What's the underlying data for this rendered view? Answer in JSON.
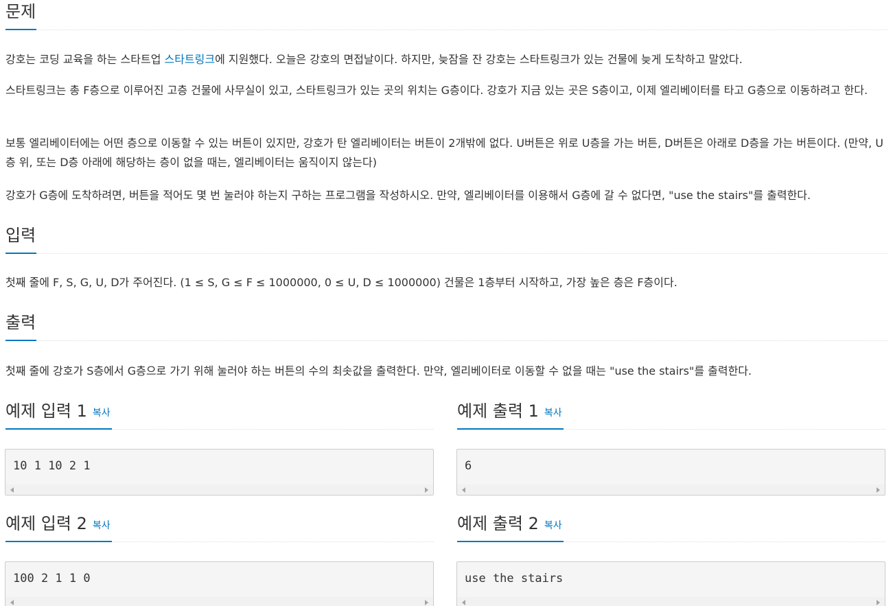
{
  "problem": {
    "title": "문제",
    "p1_before": "강호는 코딩 교육을 하는 스타트업 ",
    "p1_link": "스타트링크",
    "p1_after": "에 지원했다. 오늘은 강호의 면접날이다. 하지만, 늦잠을 잔 강호는 스타트링크가 있는 건물에 늦게 도착하고 말았다.",
    "p2": "스타트링크는 총 F층으로 이루어진 고층 건물에 사무실이 있고, 스타트링크가 있는 곳의 위치는 G층이다. 강호가 지금 있는 곳은 S층이고, 이제 엘리베이터를 타고 G층으로 이동하려고 한다.",
    "p3": "보통 엘리베이터에는 어떤 층으로 이동할 수 있는 버튼이 있지만, 강호가 탄 엘리베이터는 버튼이 2개밖에 없다. U버튼은 위로 U층을 가는 버튼, D버튼은 아래로 D층을 가는 버튼이다. (만약, U층 위, 또는 D층 아래에 해당하는 층이 없을 때는, 엘리베이터는 움직이지 않는다)",
    "p4": "강호가 G층에 도착하려면, 버튼을 적어도 몇 번 눌러야 하는지 구하는 프로그램을 작성하시오. 만약, 엘리베이터를 이용해서 G층에 갈 수 없다면, \"use the stairs\"를 출력한다."
  },
  "input_section": {
    "title": "입력",
    "text": "첫째 줄에 F, S, G, U, D가 주어진다. (1 ≤ S, G ≤ F ≤ 1000000, 0 ≤ U, D ≤ 1000000) 건물은 1층부터 시작하고, 가장 높은 층은 F층이다."
  },
  "output_section": {
    "title": "출력",
    "text": "첫째 줄에 강호가 S층에서 G층으로 가기 위해 눌러야 하는 버튼의 수의 최솟값을 출력한다. 만약, 엘리베이터로 이동할 수 없을 때는 \"use the stairs\"를 출력한다."
  },
  "samples": {
    "copy_label": "복사",
    "input1_title": "예제 입력 1",
    "input1_value": "10 1 10 2 1",
    "output1_title": "예제 출력 1",
    "output1_value": "6",
    "input2_title": "예제 입력 2",
    "input2_value": "100 2 1 1 0",
    "output2_title": "예제 출력 2",
    "output2_value": "use the stairs"
  },
  "colors": {
    "accent": "#0076c0",
    "text": "#333333",
    "box_bg": "#f5f5f5",
    "box_border": "#cccccc"
  }
}
